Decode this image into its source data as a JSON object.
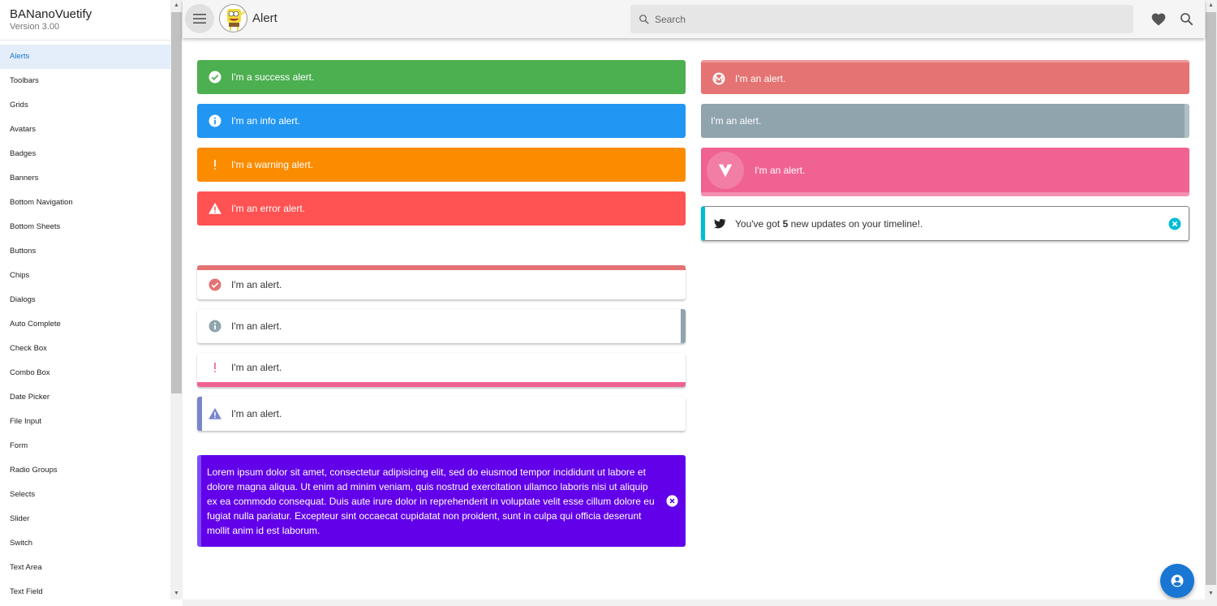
{
  "sidebar": {
    "title": "BANanoVuetify",
    "version": "Version 3.00",
    "items": [
      "Alerts",
      "Toolbars",
      "Grids",
      "Avatars",
      "Badges",
      "Banners",
      "Bottom Navigation",
      "Bottom Sheets",
      "Buttons",
      "Chips",
      "Dialogs",
      "Auto Complete",
      "Check Box",
      "Combo Box",
      "Date Picker",
      "File Input",
      "Form",
      "Radio Groups",
      "Selects",
      "Slider",
      "Switch",
      "Text Area",
      "Text Field"
    ],
    "active": "Alerts"
  },
  "toolbar": {
    "title": "Alert",
    "search_placeholder": "Search",
    "icons": [
      "menu-icon",
      "avatar",
      "heart-icon",
      "search-icon"
    ]
  },
  "alerts_left": [
    {
      "text": "I'm a success alert.",
      "color": "#4caf50",
      "icon": "check-circle-icon"
    },
    {
      "text": "I'm an info alert.",
      "color": "#2196f3",
      "icon": "info-icon"
    },
    {
      "text": "I'm a warning alert.",
      "color": "#fb8c00",
      "icon": "exclamation-icon"
    },
    {
      "text": "I'm an error alert.",
      "color": "#ff5252",
      "icon": "warning-icon"
    }
  ],
  "alerts_outlined": [
    {
      "text": "I'm an alert.",
      "color": "#e57373",
      "border": "top",
      "icon": "check-circle-icon"
    },
    {
      "text": "I'm an alert.",
      "color": "#90a4ae",
      "border": "right",
      "icon": "info-icon"
    },
    {
      "text": "I'm an alert.",
      "color": "#f06292",
      "border": "bottom",
      "icon": "exclamation-icon"
    },
    {
      "text": "I'm an alert.",
      "color": "#7986cb",
      "border": "left",
      "icon": "warning-icon"
    }
  ],
  "alerts_right": [
    {
      "text": "I'm an alert.",
      "color": "#e57373",
      "icon": "material-design-icon"
    },
    {
      "text": "I'm an alert.",
      "color": "#90a4ae"
    },
    {
      "text": "I'm an alert.",
      "color": "#f06292",
      "icon": "vuetify-icon"
    }
  ],
  "twitter": {
    "pre": "You've got ",
    "count": "5",
    "post": " new updates on your timeline!.",
    "color": "#00bcd4"
  },
  "lorem": {
    "text": "Lorem ipsum dolor sit amet, consectetur adipisicing elit, sed do eiusmod tempor incididunt ut labore et dolore magna aliqua. Ut enim ad minim veniam, quis nostrud exercitation ullamco laboris nisi ut aliquip ex ea commodo consequat. Duis aute irure dolor in reprehenderit in voluptate velit esse cillum dolore eu fugiat nulla pariatur. Excepteur sint occaecat cupidatat non proident, sunt in culpa qui officia deserunt mollit anim id est laborum.",
    "color": "#6200ea"
  }
}
